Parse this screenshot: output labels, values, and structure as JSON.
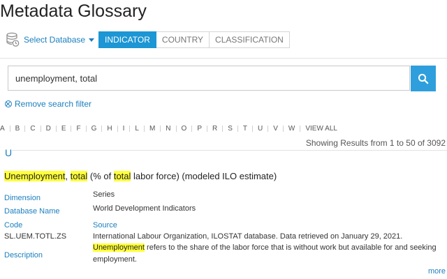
{
  "page": {
    "title": "Metadata Glossary"
  },
  "database_select": {
    "label": "Select Database",
    "icon": "database-icon"
  },
  "tabs": [
    {
      "label": "INDICATOR",
      "active": true
    },
    {
      "label": "COUNTRY",
      "active": false
    },
    {
      "label": "CLASSIFICATION",
      "active": false
    }
  ],
  "search": {
    "value": "unemployment, total",
    "icon": "search-icon"
  },
  "remove_filter": {
    "label": "Remove search filter",
    "icon": "remove-circle-icon"
  },
  "alphabet": [
    "A",
    "B",
    "C",
    "D",
    "E",
    "F",
    "G",
    "H",
    "I",
    "L",
    "M",
    "N",
    "O",
    "P",
    "R",
    "S",
    "T",
    "U",
    "V",
    "W",
    "VIEW ALL"
  ],
  "results": {
    "summary": "Showing Results from 1 to 50 of 3092"
  },
  "section_letter": "U",
  "indicator": {
    "title_parts": [
      {
        "text": "Unemployment",
        "highlight": true
      },
      {
        "text": ", ",
        "highlight": false
      },
      {
        "text": "total",
        "highlight": true
      },
      {
        "text": " (% of ",
        "highlight": false
      },
      {
        "text": "total",
        "highlight": true
      },
      {
        "text": " labor force) (modeled ILO estimate)",
        "highlight": false
      }
    ],
    "fields": {
      "dimension": {
        "label": "Dimension",
        "value": "Series"
      },
      "database_name": {
        "label": "Database Name",
        "value": "World Development Indicators"
      },
      "code": {
        "label": "Code",
        "value": "SL.UEM.TOTL.ZS"
      },
      "source": {
        "label": "Source",
        "value": "International Labour Organization, ILOSTAT database. Data retrieved on January 29, 2021."
      },
      "description": {
        "label": "Description",
        "highlight": "Unemployment",
        "line1_rest": " refers to the share of the labor force that is without work but available for and seeking",
        "line2": "employment."
      }
    },
    "more_label": "more"
  },
  "colors": {
    "accent": "#1c96d4",
    "link": "#1a7fbf",
    "highlight": "#ffff3a"
  }
}
